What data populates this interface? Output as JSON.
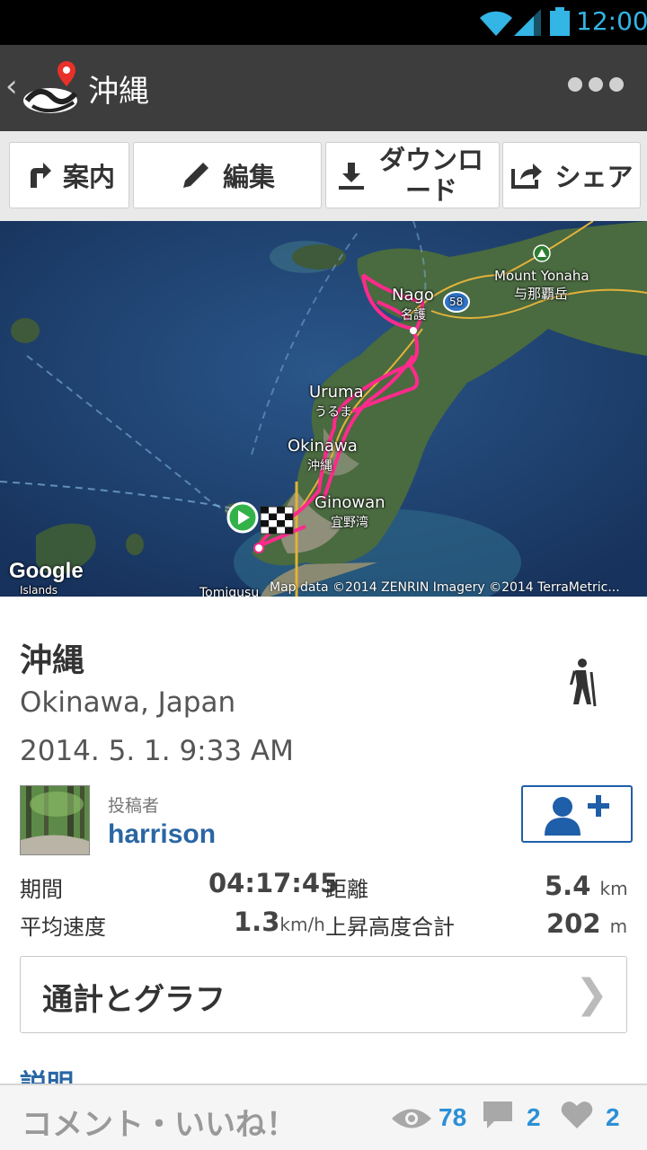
{
  "status_bar": {
    "time": "12:00",
    "accent_color": "#33b5e5"
  },
  "action_bar": {
    "title": "沖縄",
    "overflow_icon": "more-dots-icon"
  },
  "toolbar": {
    "guide_label": "案内",
    "edit_label": "編集",
    "download_label": "ダウンロード",
    "share_label": "シェア"
  },
  "map": {
    "labels": {
      "mount": "Mount Yonaha",
      "mount_jp": "与那覇岳",
      "nago": "Nago",
      "nago_jp": "名護",
      "route58": "58",
      "uruma": "Uruma",
      "uruma_jp": "うるま",
      "okinawa": "Okinawa",
      "okinawa_jp": "沖縄",
      "ginowan": "Ginowan",
      "ginowan_jp": "宜野湾",
      "tomigusuku": "Tomigusu"
    },
    "google": "Google",
    "islands": "Islands",
    "attribution": "Map data ©2014 ZENRIN  Imagery ©2014 TerraMetric...",
    "route_color": "#ff2a8c"
  },
  "detail": {
    "title": "沖縄",
    "location": "Okinawa, Japan",
    "date": "2014. 5. 1. 9:33 AM",
    "activity_icon": "hiker-icon",
    "poster_label": "投稿者",
    "poster_name": "harrison",
    "stats": {
      "duration_label": "期間",
      "duration_value": "04:17:45",
      "distance_label": "距離",
      "distance_value": "5.4",
      "distance_unit": "km",
      "speed_label": "平均速度",
      "speed_value": "1.3",
      "speed_unit": "km/h",
      "elevation_label": "上昇高度合計",
      "elevation_value": "202",
      "elevation_unit": "m"
    },
    "graph_button": "通計とグラフ",
    "graph_chevron": "❯",
    "description_peek": "説明"
  },
  "bottom_bar": {
    "comment_label": "コメント・いいね！",
    "views": "78",
    "comments": "2",
    "likes": "2"
  }
}
